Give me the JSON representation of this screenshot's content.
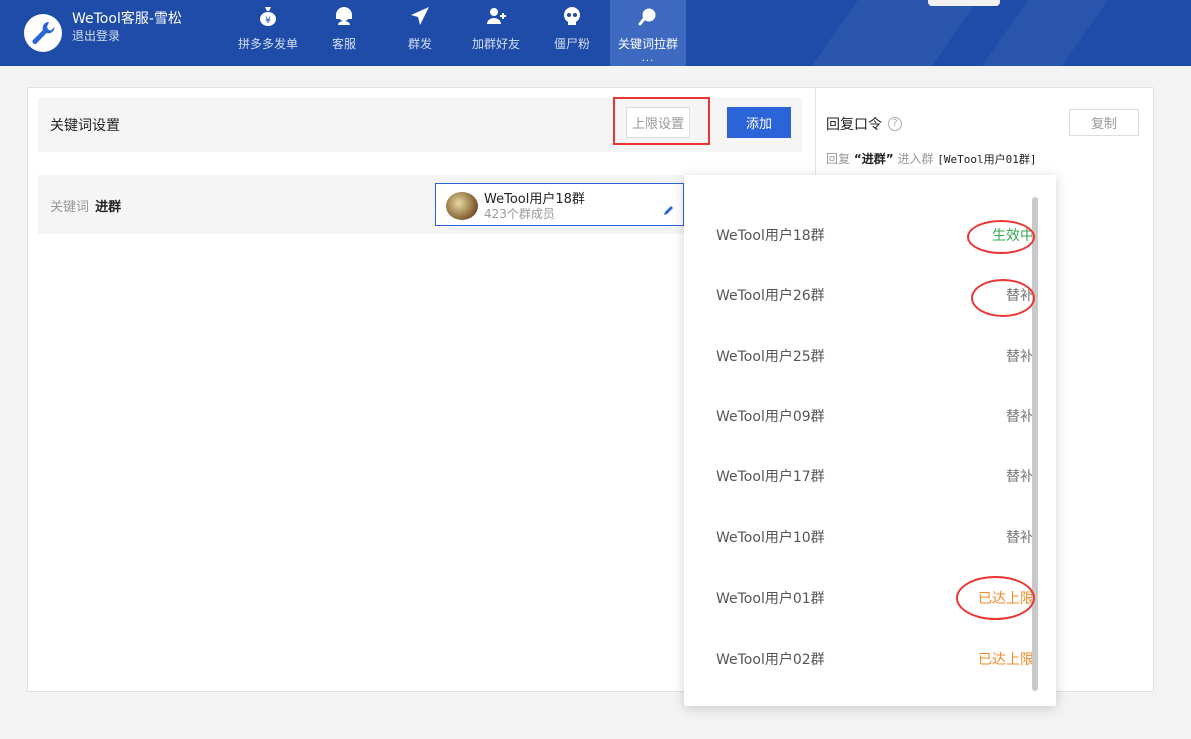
{
  "header": {
    "account_name": "WeTool客服-雪松",
    "logout_label": "退出登录",
    "nav": [
      {
        "label": "拼多多发单",
        "icon": "money-bag-icon"
      },
      {
        "label": "客服",
        "icon": "headset-icon"
      },
      {
        "label": "群发",
        "icon": "paper-plane-icon"
      },
      {
        "label": "加群好友",
        "icon": "add-user-icon"
      },
      {
        "label": "僵尸粉",
        "icon": "skull-icon"
      },
      {
        "label": "关键词拉群",
        "icon": "search-icon"
      }
    ],
    "more_dots": "..."
  },
  "keyword_settings": {
    "title": "关键词设置",
    "limit_button": "上限设置",
    "add_button": "添加"
  },
  "keyword_row": {
    "label": "关键词",
    "keyword": "进群",
    "group_name": "WeTool用户18群",
    "group_count": "423个群成员"
  },
  "reply": {
    "title": "回复口令",
    "copy_button": "复制",
    "prefix": "回复",
    "keyword": "“进群”",
    "middle": "进入群",
    "group": "[WeTool用户01群]"
  },
  "dropdown": [
    {
      "name": "WeTool用户18群",
      "status": "生效中",
      "kind": "active"
    },
    {
      "name": "WeTool用户26群",
      "status": "替补",
      "kind": "sub"
    },
    {
      "name": "WeTool用户25群",
      "status": "替补",
      "kind": "sub"
    },
    {
      "name": "WeTool用户09群",
      "status": "替补",
      "kind": "sub"
    },
    {
      "name": "WeTool用户17群",
      "status": "替补",
      "kind": "sub"
    },
    {
      "name": "WeTool用户10群",
      "status": "替补",
      "kind": "sub"
    },
    {
      "name": "WeTool用户01群",
      "status": "已达上限",
      "kind": "full"
    },
    {
      "name": "WeTool用户02群",
      "status": "已达上限",
      "kind": "full"
    }
  ],
  "colors": {
    "header": "#1e4ca8",
    "primary": "#2b63d9",
    "active": "#34a853",
    "full": "#f08a24",
    "highlight": "#e33333"
  }
}
